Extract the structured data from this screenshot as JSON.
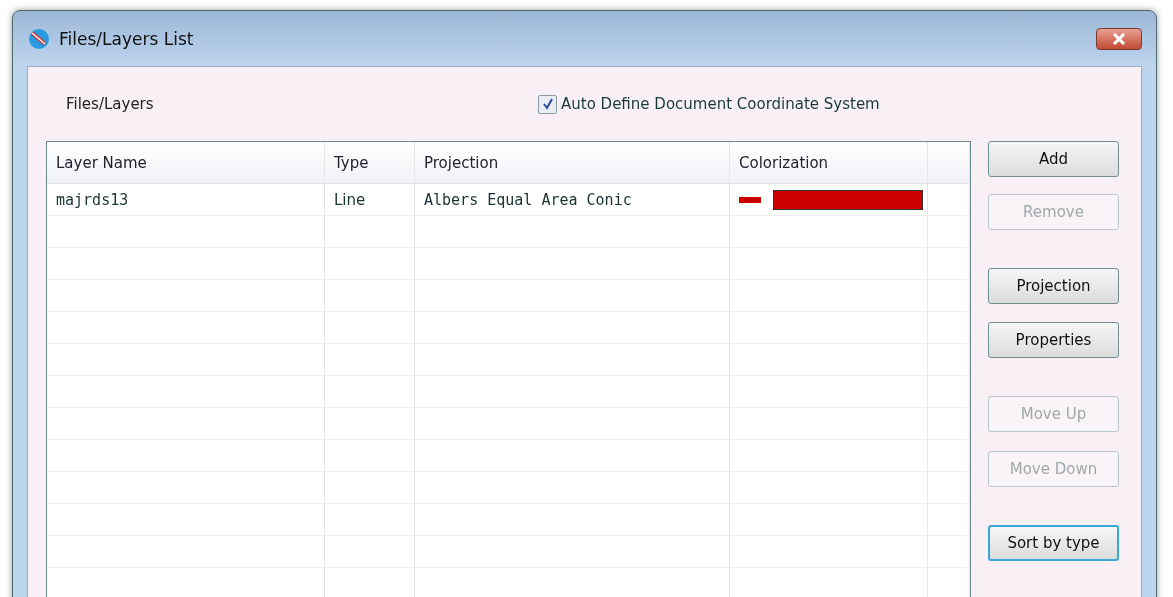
{
  "window": {
    "title": "Files/Layers List"
  },
  "section_label": "Files/Layers",
  "auto_define": {
    "label": "Auto Define Document Coordinate System",
    "checked": true
  },
  "table": {
    "columns": [
      "Layer Name",
      "Type",
      "Projection",
      "Colorization"
    ],
    "rows": [
      {
        "layer_name": "majrds13",
        "type": "Line",
        "projection": "Albers Equal Area Conic",
        "color": "#cc0000"
      }
    ]
  },
  "buttons": [
    {
      "label": "Add",
      "disabled": false,
      "focused": false
    },
    {
      "label": "Remove",
      "disabled": true,
      "focused": false
    },
    {
      "label": "Projection",
      "disabled": false,
      "focused": false
    },
    {
      "label": "Properties",
      "disabled": false,
      "focused": false
    },
    {
      "label": "Move Up",
      "disabled": true,
      "focused": false
    },
    {
      "label": "Move Down",
      "disabled": true,
      "focused": false
    },
    {
      "label": "Sort by type",
      "disabled": false,
      "focused": true
    }
  ]
}
